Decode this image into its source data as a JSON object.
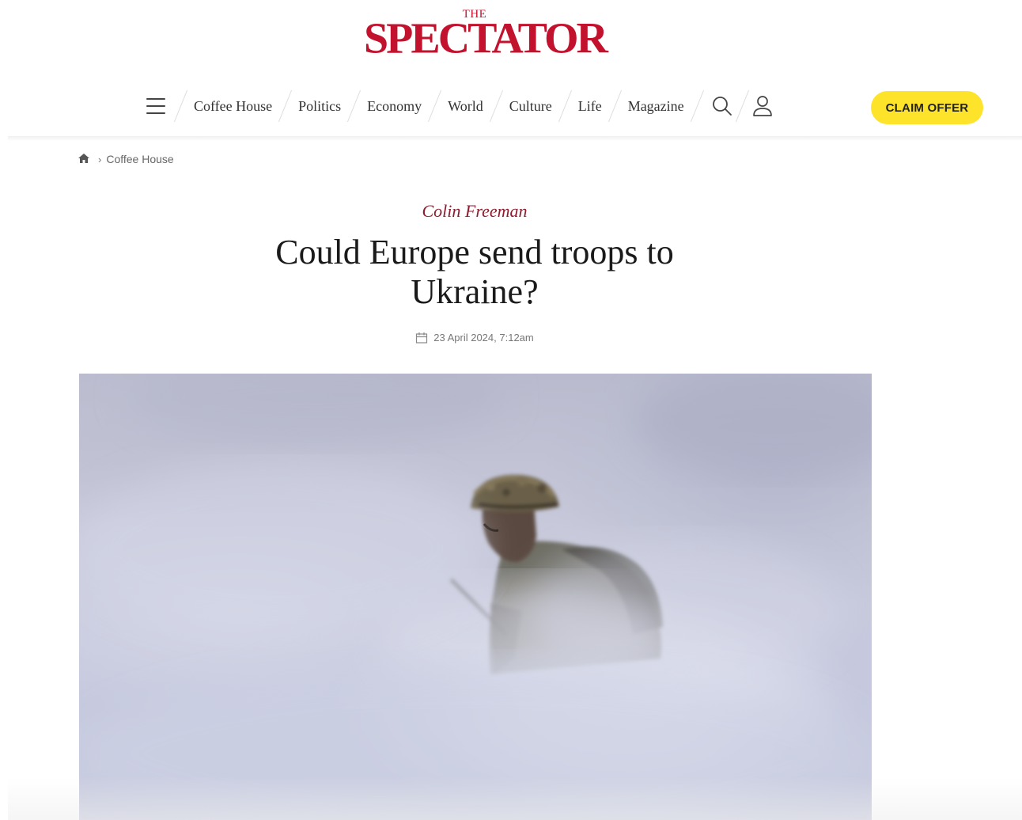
{
  "site": {
    "logo_small": "THE",
    "logo_main": "SPECTATOR"
  },
  "nav": {
    "items": [
      "Coffee House",
      "Politics",
      "Economy",
      "World",
      "Culture",
      "Life",
      "Magazine"
    ],
    "cta": "CLAIM OFFER"
  },
  "breadcrumb": {
    "section": "Coffee House"
  },
  "article": {
    "author": "Colin Freeman",
    "headline": "Could Europe send troops to Ukraine?",
    "date": "23 April 2024, 7:12am"
  },
  "icons": {
    "menu": "hamburger-menu-icon",
    "search": "search-icon",
    "account": "user-icon",
    "home": "home-icon",
    "calendar": "calendar-icon"
  },
  "colors": {
    "brand_red": "#c3122e",
    "author_red": "#8e1b2e",
    "cta_yellow": "#fde32a"
  }
}
